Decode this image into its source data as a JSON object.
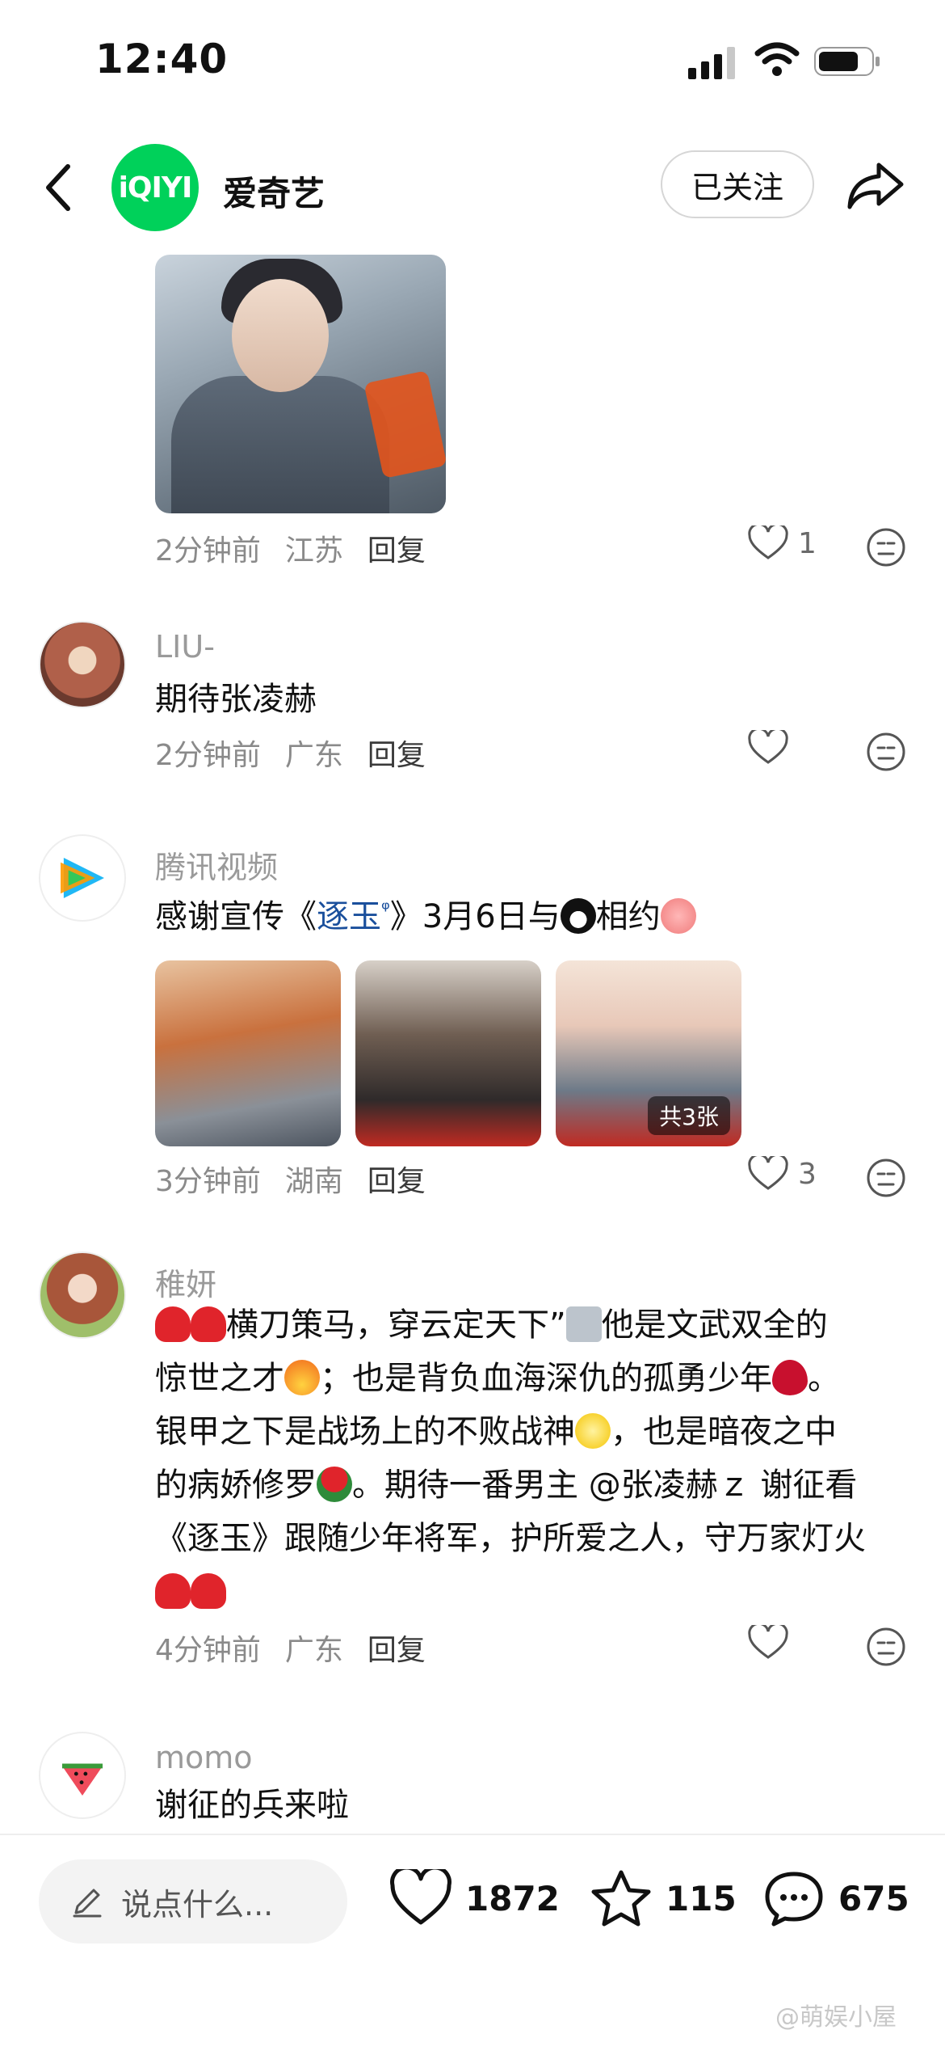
{
  "status_bar": {
    "time": "12:40"
  },
  "header": {
    "back_icon": "chevron-left-icon",
    "logo_text": "iQIYI",
    "account_name": "爱奇艺",
    "follow_label": "已关注",
    "share_icon": "share-icon"
  },
  "comments": [
    {
      "user": "",
      "text": "",
      "time": "2分钟前",
      "location": "江苏",
      "reply_label": "回复",
      "likes": "1"
    },
    {
      "user": "LIU-",
      "text": "期待张凌赫",
      "time": "2分钟前",
      "location": "广东",
      "reply_label": "回复",
      "likes": ""
    },
    {
      "user": "腾讯视频",
      "text_before": "感谢宣传《",
      "keyword": "逐玉",
      "text_after": "》3月6日与",
      "text_end": "相约",
      "time": "3分钟前",
      "location": "湖南",
      "reply_label": "回复",
      "likes": "3",
      "image_badge": "共3张"
    },
    {
      "user": "稚妍",
      "line1": "横刀策马，穿云定天下”",
      "line1b": "他是文武双全的",
      "line2a": "惊世之才",
      "line2b": "；也是背负血海深仇的孤勇少年",
      "line2c": "。",
      "line3a": "银甲之下是战场上的不败战神",
      "line3b": "，也是暗夜之中",
      "line4a": "的病娇修罗",
      "line4b": "。期待一番男主 @张凌赫ｚ 谢征看",
      "line5": "《逐玉》跟随少年将军，护所爱之人，守万家灯火",
      "time": "4分钟前",
      "location": "广东",
      "reply_label": "回复",
      "likes": ""
    },
    {
      "user": "momo",
      "text": "谢征的兵来啦"
    }
  ],
  "bottom_bar": {
    "input_placeholder": "说点什么...",
    "likes": "1872",
    "favorites": "115",
    "comments": "675"
  },
  "watermark": "@萌娱小屋",
  "colors": {
    "brand": "#00d15a",
    "keyword": "#1a4f9c",
    "meta": "#8a8a8a"
  }
}
